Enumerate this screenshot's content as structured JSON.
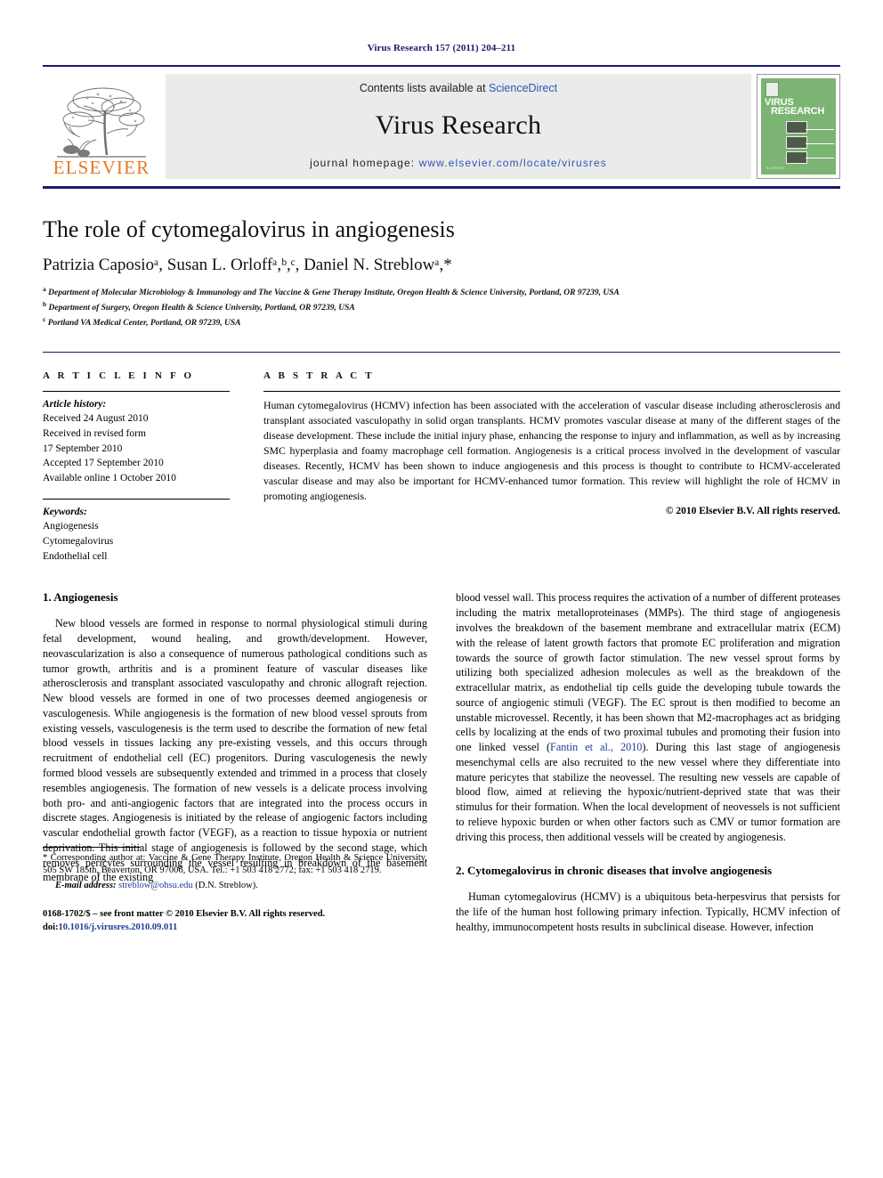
{
  "running_head": "Virus Research 157 (2011) 204–211",
  "masthead": {
    "publisher_name": "ELSEVIER",
    "contents_prefix": "Contents lists available at",
    "contents_link": "ScienceDirect",
    "journal_name": "Virus Research",
    "homepage_prefix": "journal homepage:",
    "homepage_url": "www.elsevier.com/locate/virusres",
    "cover": {
      "title_line1": "VIRUS",
      "title_line2": "RESEARCH",
      "footer": "ELSEVIER"
    },
    "accent_color": "#1a1a6e",
    "link_color": "#2b57b0",
    "elsevier_orange": "#E87722",
    "cover_green": "#7cb473"
  },
  "title": "The role of cytomegalovirus in angiogenesis",
  "authors": "Patrizia Caposioᵃ, Susan L. Orloffᵃ,ᵇ,ᶜ, Daniel N. Streblowᵃ,*",
  "affiliations": [
    "a Department of Molecular Microbiology & Immunology and The Vaccine & Gene Therapy Institute, Oregon Health & Science University, Portland, OR 97239, USA",
    "b Department of Surgery, Oregon Health & Science University, Portland, OR 97239, USA",
    "c Portland VA Medical Center, Portland, OR 97239, USA"
  ],
  "article_info": {
    "heading": "A R T I C L E   I N F O",
    "history_label": "Article history:",
    "history": [
      "Received 24 August 2010",
      "Received in revised form",
      "17 September 2010",
      "Accepted 17 September 2010",
      "Available online 1 October 2010"
    ],
    "keywords_label": "Keywords:",
    "keywords": [
      "Angiogenesis",
      "Cytomegalovirus",
      "Endothelial cell"
    ]
  },
  "abstract": {
    "heading": "A B S T R A C T",
    "text": "Human cytomegalovirus (HCMV) infection has been associated with the acceleration of vascular disease including atherosclerosis and transplant associated vasculopathy in solid organ transplants. HCMV promotes vascular disease at many of the different stages of the disease development. These include the initial injury phase, enhancing the response to injury and inflammation, as well as by increasing SMC hyperplasia and foamy macrophage cell formation. Angiogenesis is a critical process involved in the development of vascular diseases. Recently, HCMV has been shown to induce angiogenesis and this process is thought to contribute to HCMV-accelerated vascular disease and may also be important for HCMV-enhanced tumor formation. This review will highlight the role of HCMV in promoting angiogenesis.",
    "copyright": "© 2010 Elsevier B.V. All rights reserved."
  },
  "sections": {
    "s1_heading": "1. Angiogenesis",
    "s1_p1": "New blood vessels are formed in response to normal physiological stimuli during fetal development, wound healing, and growth/development. However, neovascularization is also a consequence of numerous pathological conditions such as tumor growth, arthritis and is a prominent feature of vascular diseases like atherosclerosis and transplant associated vasculopathy and chronic allograft rejection. New blood vessels are formed in one of two processes deemed angiogenesis or vasculogenesis. While angiogenesis is the formation of new blood vessel sprouts from existing vessels, vasculogenesis is the term used to describe the formation of new fetal blood vessels in tissues lacking any pre-existing vessels, and this occurs through recruitment of endothelial cell (EC) progenitors. During vasculogenesis the newly formed blood vessels are subsequently extended and trimmed in a process that closely resembles angiogenesis. The formation of new vessels is a delicate process involving both pro- and anti-angiogenic factors that are integrated into the process occurs in discrete stages. Angiogenesis is initiated by the release of angiogenic factors including vascular endothelial growth factor (VEGF), as a reaction to tissue hypoxia or nutrient deprivation. This initial stage of angiogenesis is followed by the second stage, which removes pericytes surrounding the vessel resulting in breakdown of the basement membrane of the existing",
    "s1_p1_cont_a": "blood vessel wall. This process requires the activation of a number of different proteases including the matrix metalloproteinases (MMPs). The third stage of angiogenesis involves the breakdown of the basement membrane and extracellular matrix (ECM) with the release of latent growth factors that promote EC proliferation and migration towards the source of growth factor stimulation. The new vessel sprout forms by utilizing both specialized adhesion molecules as well as the breakdown of the extracellular matrix, as endothelial tip cells guide the developing tubule towards the source of angiogenic stimuli (VEGF). The EC sprout is then modified to become an unstable microvessel. Recently, it has been shown that M2-macrophages act as bridging cells by localizing at the ends of two proximal tubules and promoting their fusion into one linked vessel (",
    "s1_citation": "Fantin et al., 2010",
    "s1_p1_cont_b": "). During this last stage of angiogenesis mesenchymal cells are also recruited to the new vessel where they differentiate into mature pericytes that stabilize the neovessel. The resulting new vessels are capable of blood flow, aimed at relieving the hypoxic/nutrient-deprived state that was their stimulus for their formation. When the local development of neovessels is not sufficient to relieve hypoxic burden or when other factors such as CMV or tumor formation are driving this process, then additional vessels will be created by angiogenesis.",
    "s2_heading": "2. Cytomegalovirus in chronic diseases that involve angiogenesis",
    "s2_p1": "Human cytomegalovirus (HCMV) is a ubiquitous beta-herpesvirus that persists for the life of the human host following primary infection. Typically, HCMV infection of healthy, immunocompetent hosts results in subclinical disease. However, infection"
  },
  "footnotes": {
    "corresponding": "* Corresponding author at: Vaccine & Gene Therapy Institute, Oregon Health & Science University, 505 SW 185th, Beaverton, OR 97006, USA. Tel.: +1 503 418 2772; fax: +1 503 418 2719.",
    "email_label": "E-mail address:",
    "email": "streblow@ohsu.edu",
    "email_owner": "(D.N. Streblow).",
    "issn_line": "0168-1702/$ – see front matter © 2010 Elsevier B.V. All rights reserved.",
    "doi_prefix": "doi:",
    "doi": "10.1016/j.virusres.2010.09.011"
  }
}
